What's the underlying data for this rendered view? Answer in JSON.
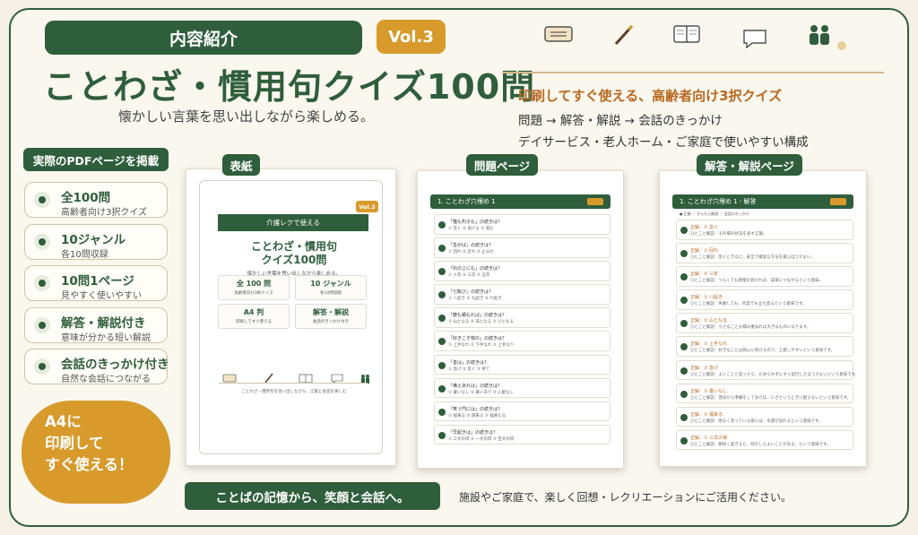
{
  "header": {
    "tag": "内容紹介",
    "vol": "Vol.3",
    "title": "ことわざ・慣用句クイズ100問",
    "subtitle": "懐かしい言葉を思い出しながら楽しめる。"
  },
  "right_copy": {
    "headline": "印刷してすぐ使える、高齢者向け3択クイズ",
    "line1": "問題 → 解答・解説 → 会話のきっかけ",
    "line2": "デイサービス・老人ホーム・ご家庭で使いやすい構成"
  },
  "icons": [
    "ticket-icon",
    "pencil-icon",
    "book-icon",
    "speech-bubble-icon",
    "people-icon"
  ],
  "colors": {
    "green": "#2f5e3c",
    "orange": "#d79a2b",
    "cream": "#f5f1e6"
  },
  "sidebar": {
    "badge": "実際のPDFページを掲載",
    "features": [
      {
        "title": "全100問",
        "sub": "高齢者向け3択クイズ"
      },
      {
        "title": "10ジャンル",
        "sub": "各10問収録"
      },
      {
        "title": "10問1ページ",
        "sub": "見やすく使いやすい"
      },
      {
        "title": "解答・解説付き",
        "sub": "意味が分かる短い解説"
      },
      {
        "title": "会話のきっかけ付き",
        "sub": "自然な会話につながる"
      }
    ],
    "cta_line1": "A4に",
    "cta_line2": "印刷して",
    "cta_line3": "すぐ使える！"
  },
  "panels": {
    "cover_label": "表紙",
    "question_label": "問題ページ",
    "answer_label": "解答・解説ページ"
  },
  "cover": {
    "band": "介護レクで使える",
    "vol": "Vol.3",
    "title_line1": "ことわざ・慣用句",
    "title_line2": "クイズ100問",
    "sub": "懐かしい言葉を思い出しながら楽しめる。",
    "box1_title": "全 100 問",
    "box1_sub": "高齢者向け3択クイズ",
    "box2_title": "10 ジャンル",
    "box2_sub": "各10問収録",
    "box3_title": "A4 判",
    "box3_sub": "印刷してすぐ使える",
    "box4_title": "解答・解説",
    "box4_sub": "会話のきっかけ付き",
    "footer": "ことわざ・慣用句を思い出しながら、言葉と会話を楽しむ"
  },
  "question_page": {
    "header": "1. ことわざ穴埋め 1",
    "questions": [
      {
        "q": "「猫も杓子も」の続きは？",
        "a": "① 急ぐ ② 逃げる ③ 進む"
      },
      {
        "q": "「急がば」の続きは？",
        "a": "① 回れ ② 走れ ③ 止まれ"
      },
      {
        "q": "「石の上にも」の続きは？",
        "a": "① 十年 ② 三年 ③ 五年"
      },
      {
        "q": "「七転び」の続きは？",
        "a": "① 八起き ② 九起き ③ 六起き"
      },
      {
        "q": "「塵も積もれば」の続きは？",
        "a": "① 山となる ② 海となる ③ 川となる"
      },
      {
        "q": "「好きこそ物の」の続きは？",
        "a": "① 上手なれ ② 下手なれ ③ 上手なり"
      },
      {
        "q": "「善は」の続きは？",
        "a": "① 急げ ② 急ぐ ③ 待て"
      },
      {
        "q": "「備えあれば」の続きは？",
        "a": "① 憂いなし ② 憂いあり ③ 心配なし"
      },
      {
        "q": "「笑う門には」の続きは？",
        "a": "① 福来る ② 運来る ③ 福来たる"
      },
      {
        "q": "「早起きは」の続きは？",
        "a": "① 三文の得 ② 一文の得 ③ 百文の得"
      }
    ]
  },
  "answer_page": {
    "header": "1. ことわざ穴埋め 1 - 解答",
    "sub": "● 正解 ／ かんたん解説 ／ 会話のきっかけ",
    "answers": [
      {
        "a": "正解：① 急ぐ",
        "b": "ひとこと解説：その場の状況を表す言葉。"
      },
      {
        "a": "正解：① 回れ",
        "b": "ひとこと解説：急ぐときほど、安全で確実な方法を選ぶほうがよい。"
      },
      {
        "a": "正解：② 三年",
        "b": "ひとこと解説：つらくても我慢を続ければ、成果につながるという意味。"
      },
      {
        "a": "正解：① 八起き",
        "b": "ひとこと解説：失敗しても、何度でも立ち直るという意味です。"
      },
      {
        "a": "正解：① 山となる",
        "b": "ひとこと解説：小さなことも積み重ねれば大きなものになります。"
      },
      {
        "a": "正解：① 上手なれ",
        "b": "ひとこと解説：好きなことは熱心に続けるので、上達しやすいという意味です。"
      },
      {
        "a": "正解：① 急げ",
        "b": "ひとこと解説：よいことと思ったら、ためらわずにすぐ実行したほうがよいという意味です。"
      },
      {
        "a": "正解：① 憂いなし",
        "b": "ひとこと解説：普段から準備をしておけば、いざというときに困らないという意味です。"
      },
      {
        "a": "正解：① 福来る",
        "b": "ひとこと解説：明るく笑っている家には、幸運が訪れるという意味です。"
      },
      {
        "a": "正解：① 三文の得",
        "b": "ひとこと解説：朝早く起きると、何かしらよいことがある、という意味です。"
      }
    ]
  },
  "bottom": {
    "pill": "ことばの記憶から、笑顔と会話へ。",
    "text": "施設やご家庭で、楽しく回想・レクリエーションにご活用ください。"
  }
}
